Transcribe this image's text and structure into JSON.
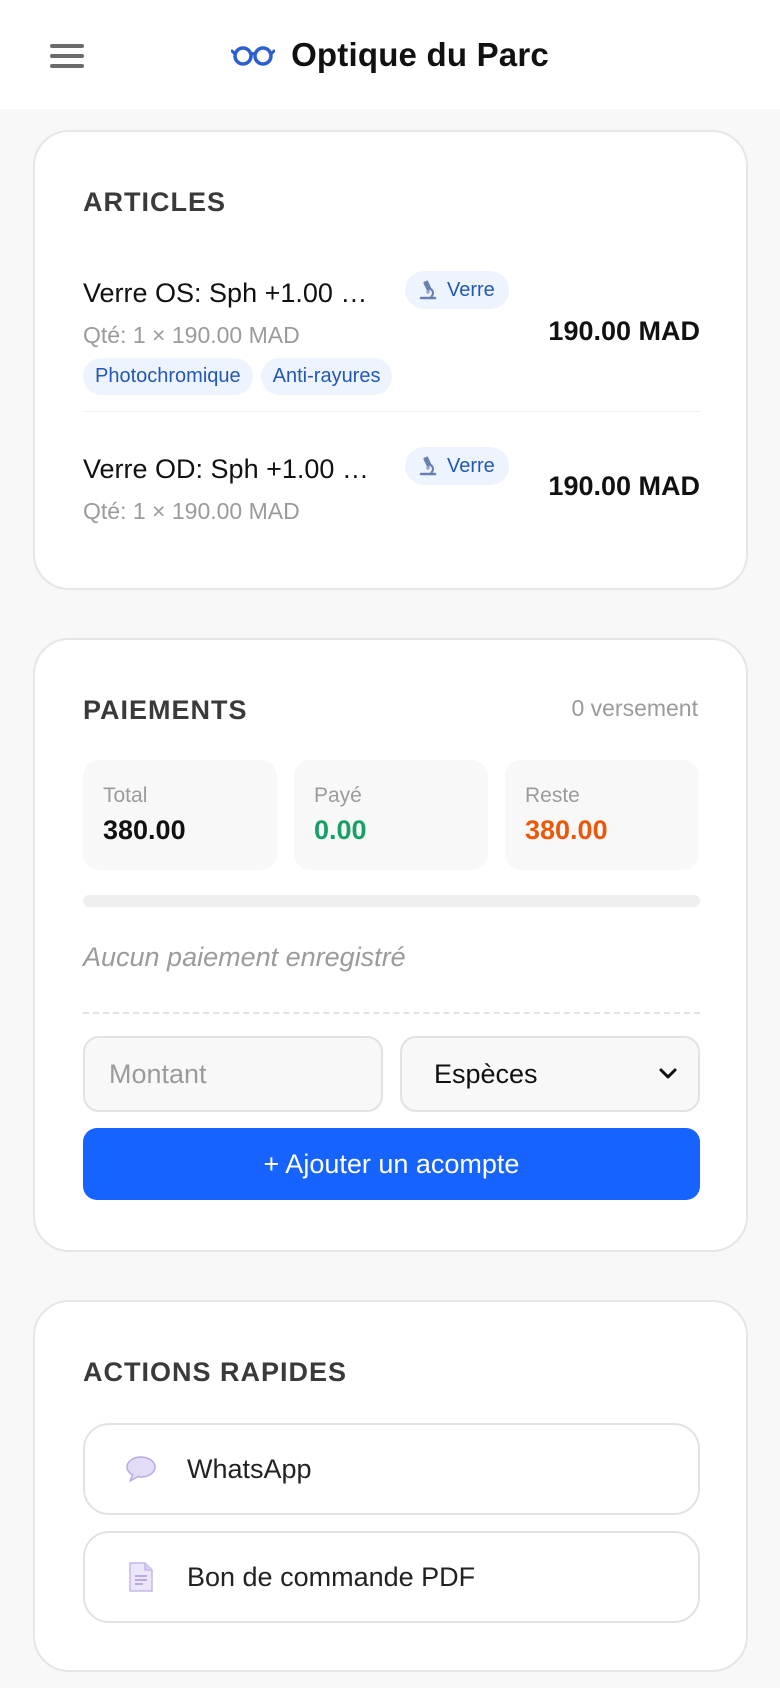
{
  "header": {
    "title": "Optique du Parc",
    "menu_icon": "hamburger-icon",
    "logo_icon": "glasses-icon"
  },
  "articles": {
    "title": "ARTICLES",
    "items": [
      {
        "name": "Verre OS: Sph +1.00 …",
        "type": "Verre",
        "type_icon": "microscope-icon",
        "qty": "Qté: 1 × 190.00 MAD",
        "price": "190.00 MAD",
        "tags": [
          "Photochromique",
          "Anti-rayures"
        ]
      },
      {
        "name": "Verre OD: Sph +1.00 …",
        "type": "Verre",
        "type_icon": "microscope-icon",
        "qty": "Qté: 1 × 190.00 MAD",
        "price": "190.00 MAD",
        "tags": []
      }
    ]
  },
  "payments": {
    "title": "PAIEMENTS",
    "count": "0 versement",
    "total_label": "Total",
    "total_value": "380.00",
    "paid_label": "Payé",
    "paid_value": "0.00",
    "rest_label": "Reste",
    "rest_value": "380.00",
    "progress_fraction": 0,
    "empty_message": "Aucun paiement enregistré",
    "amount_placeholder": "Montant",
    "method_selected": "Espèces",
    "add_button": "+ Ajouter un acompte",
    "colors": {
      "paid": "#16a067",
      "rest": "#ea580c",
      "button": "#1763ff"
    }
  },
  "actions": {
    "title": "ACTIONS RAPIDES",
    "items": [
      {
        "label": "WhatsApp",
        "icon": "speech-bubble-icon"
      },
      {
        "label": "Bon de commande PDF",
        "icon": "document-icon"
      }
    ]
  }
}
